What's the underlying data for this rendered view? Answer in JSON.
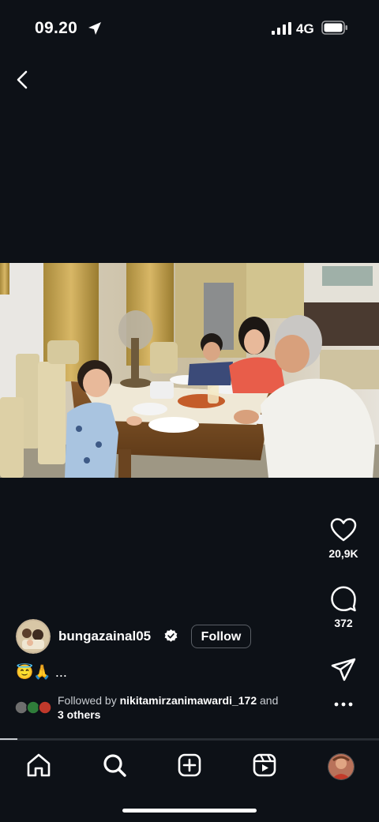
{
  "status_bar": {
    "time": "09.20",
    "network": "4G"
  },
  "post": {
    "username": "bungazainal05",
    "follow_label": "Follow",
    "caption_emoji": "😇🙏",
    "caption_more": "...",
    "followed_prefix": "Followed by",
    "followed_name": "nikitamirzanimawardi_172",
    "followed_and": "and",
    "followed_others": "3 others",
    "progress": 0.045
  },
  "actions": {
    "likes": "20,9K",
    "comments": "372"
  },
  "icons": {
    "status": [
      "location-arrow-icon",
      "signal-icon",
      "battery-icon"
    ],
    "nav": [
      "back-icon"
    ],
    "rail": [
      "heart-icon",
      "comment-icon",
      "share-icon",
      "more-icon"
    ],
    "tabs": [
      "home-icon",
      "search-icon",
      "create-icon",
      "reels-icon",
      "profile-avatar"
    ]
  },
  "colors": {
    "background": "#0d1117",
    "verified": "#ffffff",
    "text": "#ffffff"
  }
}
